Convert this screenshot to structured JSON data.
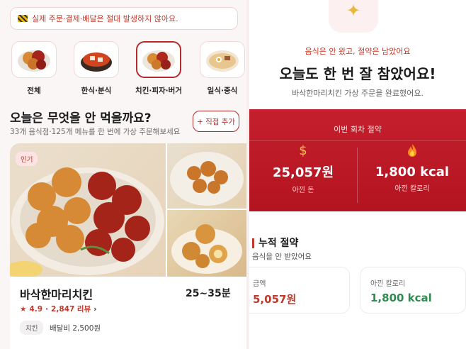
{
  "notice": {
    "text": "실제 주문·결제·배달은 절대 발생하지 않아요."
  },
  "categories": [
    {
      "label": "전체"
    },
    {
      "label": "한식·분식"
    },
    {
      "label": "치킨·피자·버거"
    },
    {
      "label": "일식·중식"
    }
  ],
  "section": {
    "title": "오늘은 무엇을 안 먹을까요?",
    "subtitle": "33개 음식점·125개 메뉴를 한 번에 가상 주문해보세요",
    "add_label": "+ 직접 추가"
  },
  "restaurant": {
    "badge": "인기",
    "name": "바삭한마리치킨",
    "time": "25~35분",
    "rating": "4.9",
    "reviews": "2,847 리뷰",
    "tag": "치킨",
    "fee": "배달비 2,500원"
  },
  "result": {
    "kicker": "음식은 안 왔고, 절약은 남았어요",
    "headline": "오늘도 한 번 잘 참았어요!",
    "description": "바삭한마리치킨 가상 주문을 완료했어요.",
    "round_title": "이번 회차 절약",
    "money_value": "25,057원",
    "money_caption": "아낀 돈",
    "cal_value": "1,800 kcal",
    "cal_caption": "아낀 칼로리"
  },
  "cumulative": {
    "title": "누적 절약",
    "subtitle": "음식을 안 받았어요",
    "money_caption": "금액",
    "money_value": "5,057원",
    "cal_caption": "아낀 칼로리",
    "cal_value": "1,800 kcal"
  },
  "icons": {
    "sparkle": "sparkle-icon",
    "money": "money-bag-icon",
    "fire": "fire-icon",
    "star": "star-icon",
    "warning": "warning-stripe-icon"
  },
  "colors": {
    "accent": "#c0392b",
    "banner": "#c41f2d",
    "green": "#2e8b4f"
  }
}
